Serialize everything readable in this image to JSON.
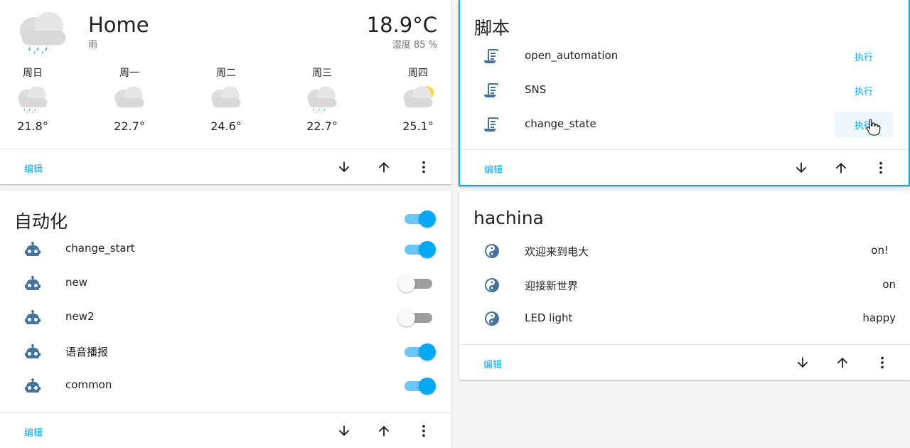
{
  "weather": {
    "name": "Home",
    "state": "雨",
    "temperature": "18.9°C",
    "humidity": "湿度 85 %",
    "current_icon": "rainy-cloud-icon",
    "forecast": [
      {
        "day": "周日",
        "temp": "21.8°",
        "icon": "rainy-cloud-icon"
      },
      {
        "day": "周一",
        "temp": "22.7°",
        "icon": "cloudy-icon"
      },
      {
        "day": "周二",
        "temp": "24.6°",
        "icon": "cloudy-icon"
      },
      {
        "day": "周三",
        "temp": "22.7°",
        "icon": "rainy-cloud-icon"
      },
      {
        "day": "周四",
        "temp": "25.1°",
        "icon": "partly-cloudy-icon"
      }
    ],
    "edit_label": "编辑"
  },
  "scripts": {
    "title": "脚本",
    "items": [
      {
        "name": "open_automation",
        "action": "执行",
        "icon": "script-icon"
      },
      {
        "name": "SNS",
        "action": "执行",
        "icon": "script-icon"
      },
      {
        "name": "change_state",
        "action": "执行",
        "icon": "script-icon"
      }
    ],
    "edit_label": "编辑"
  },
  "automations": {
    "title": "自动化",
    "header_toggle_on": true,
    "items": [
      {
        "name": "change_start",
        "on": true,
        "icon": "robot-icon"
      },
      {
        "name": "new",
        "on": false,
        "icon": "robot-icon"
      },
      {
        "name": "new2",
        "on": false,
        "icon": "robot-icon"
      },
      {
        "name": "语音播报",
        "on": true,
        "icon": "robot-icon"
      },
      {
        "name": "common",
        "on": true,
        "icon": "robot-icon"
      }
    ],
    "edit_label": "编辑"
  },
  "hachina": {
    "title": "hachina",
    "items": [
      {
        "name": "欢迎来到电大",
        "value": "on!",
        "icon": "yin-yang-icon"
      },
      {
        "name": "迎接新世界",
        "value": "on",
        "icon": "yin-yang-icon"
      },
      {
        "name": "LED light",
        "value": "happy",
        "icon": "yin-yang-icon"
      }
    ],
    "edit_label": "编辑"
  },
  "colors": {
    "accent": "#03a9f4",
    "icon": "#44739e",
    "text": "#212121",
    "secondary_text": "#727272"
  }
}
